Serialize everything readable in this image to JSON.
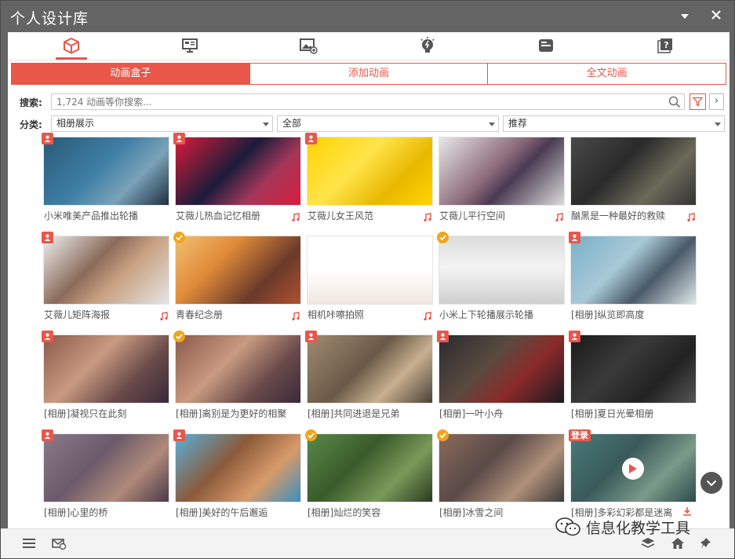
{
  "window": {
    "title": "个人设计库",
    "minimize_icon": "dropdown-icon",
    "close_icon": "close-icon"
  },
  "toolbar_icons": [
    "animation-box-icon",
    "presentation-icon",
    "image-add-icon",
    "lightbulb-icon",
    "storage-icon",
    "help-icon"
  ],
  "tabs": [
    {
      "label": "动画盒子",
      "active": true
    },
    {
      "label": "添加动画",
      "active": false
    },
    {
      "label": "全文动画",
      "active": false
    }
  ],
  "search": {
    "label": "搜索:",
    "placeholder": "1,724 动画等你搜索..."
  },
  "filters": {
    "label": "分类:",
    "category": "相册展示",
    "scope": "全部",
    "sort": "推荐"
  },
  "items": [
    {
      "caption": "小米唯美产品推出轮播",
      "badge": "person",
      "music": false
    },
    {
      "caption": "艾薇儿热血记忆相册",
      "badge": "person",
      "music": true
    },
    {
      "caption": "艾薇儿女王风范",
      "badge": "person",
      "music": true
    },
    {
      "caption": "艾薇儿平行空间",
      "badge": "",
      "music": true
    },
    {
      "caption": "酗黑是一种最好的救赎",
      "badge": "",
      "music": true
    },
    {
      "caption": "艾薇儿矩阵海报",
      "badge": "person",
      "music": true
    },
    {
      "caption": "青春纪念册",
      "badge": "check",
      "music": true
    },
    {
      "caption": "相机咔嚓拍照",
      "badge": "",
      "music": true
    },
    {
      "caption": "小米上下轮播展示轮播",
      "badge": "check",
      "music": false
    },
    {
      "caption": "[相册]纵览即高度",
      "badge": "person",
      "music": false
    },
    {
      "caption": "[相册]凝视只在此刻",
      "badge": "person",
      "music": false
    },
    {
      "caption": "[相册]离别是为更好的相聚",
      "badge": "check",
      "music": false
    },
    {
      "caption": "[相册]共同进退是兄弟",
      "badge": "person",
      "music": false
    },
    {
      "caption": "[相册]一叶小舟",
      "badge": "person",
      "music": false
    },
    {
      "caption": "[相册]夏日光晕相册",
      "badge": "person",
      "music": false
    },
    {
      "caption": "[相册]心里的桥",
      "badge": "person",
      "music": false
    },
    {
      "caption": "[相册]美好的午后邂逅",
      "badge": "person",
      "music": false
    },
    {
      "caption": "[相册]灿烂的笑容",
      "badge": "check",
      "music": false
    },
    {
      "caption": "[相册]冰雪之间",
      "badge": "check",
      "music": false
    },
    {
      "caption": "[相册]多彩幻彩都是迷离",
      "badge": "login",
      "badge_text": "登录",
      "music": false
    }
  ],
  "statusbar_icons": [
    "menu-icon",
    "mail-icon",
    "layers-icon",
    "home-icon",
    "pin-icon"
  ],
  "watermark": "信息化教学工具",
  "colors": {
    "accent": "#e8574a",
    "titlebar": "#646464",
    "check": "#f0a51e"
  }
}
